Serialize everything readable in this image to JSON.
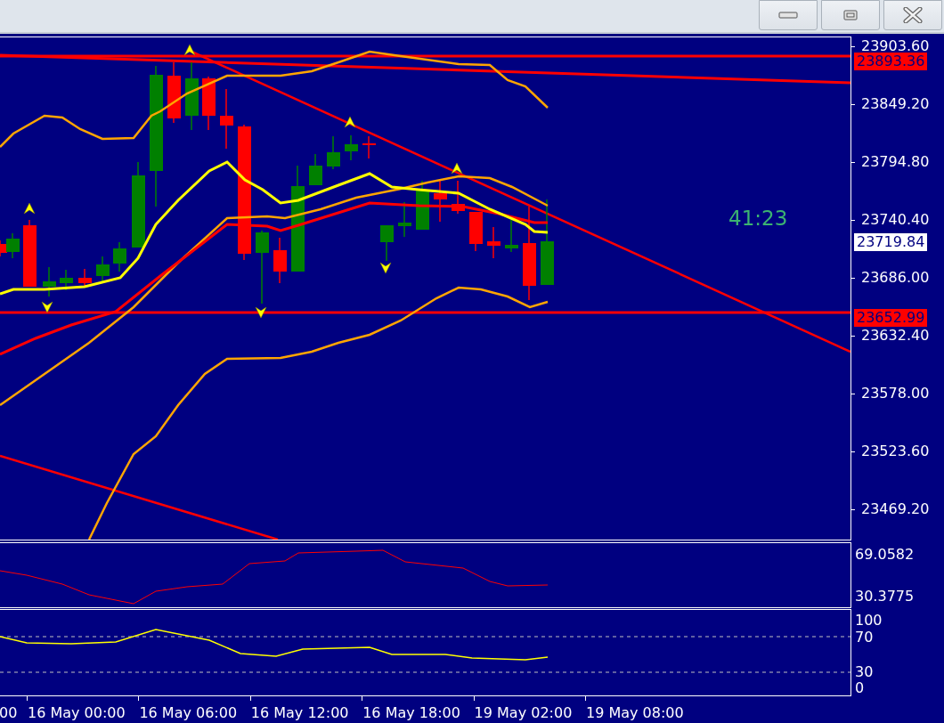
{
  "window": {
    "buttons": [
      {
        "kind": "minimize"
      },
      {
        "kind": "maximize"
      },
      {
        "kind": "close"
      }
    ]
  },
  "chart": {
    "countdown": "41:23",
    "price_axis": [
      {
        "label": "23903.60",
        "kind": "tick"
      },
      {
        "label": "23893.36",
        "kind": "line"
      },
      {
        "label": "23849.20",
        "kind": "tick"
      },
      {
        "label": "23794.80",
        "kind": "tick"
      },
      {
        "label": "23740.40",
        "kind": "tick"
      },
      {
        "label": "23719.84",
        "kind": "bid"
      },
      {
        "label": "23686.00",
        "kind": "tick"
      },
      {
        "label": "23652.99",
        "kind": "line"
      },
      {
        "label": "23632.40",
        "kind": "tick"
      },
      {
        "label": "23578.00",
        "kind": "tick"
      },
      {
        "label": "23523.60",
        "kind": "tick"
      },
      {
        "label": "23469.20",
        "kind": "tick"
      }
    ],
    "indicator_1_axis": [
      "69.0582",
      "30.3775"
    ],
    "indicator_2_axis": [
      "100",
      "70",
      "30",
      "0"
    ],
    "time_axis": [
      "00",
      "16 May 00:00",
      "16 May 06:00",
      "16 May 12:00",
      "16 May 18:00",
      "19 May 02:00",
      "19 May 08:00"
    ]
  }
}
